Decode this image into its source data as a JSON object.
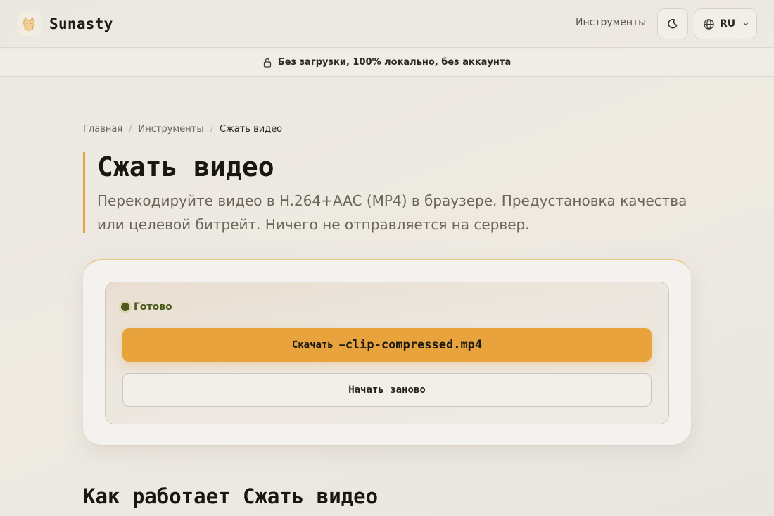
{
  "header": {
    "brand": "Sunasty",
    "nav_tools": "Инструменты",
    "lang": "RU",
    "icons": {
      "logo": "cat-logo-icon",
      "theme": "moon-icon",
      "lang": "globe-icon",
      "lang_chevron": "chevron-down-icon"
    }
  },
  "banner": {
    "text": "Без загрузки, 100% локально, без аккаунта",
    "icon": "lock-icon"
  },
  "breadcrumb": {
    "home": "Главная",
    "sep1": "/",
    "tools": "Инструменты",
    "sep2": "/",
    "current": "Сжать видео"
  },
  "hero": {
    "title": "Сжать видео",
    "description": "Перекодируйте видео в H.264+AAC (MP4) в браузере. Предустановка качества или целевой битрейт. Ничего не отправляется на сервер."
  },
  "result": {
    "status": "Готово",
    "download_prefix": "Скачать — ",
    "filename": "clip-compressed.mp4",
    "restart": "Начать заново"
  },
  "section": {
    "title": "Как работает Сжать видео"
  },
  "colors": {
    "accent": "#e8a33d",
    "status_green": "#4b5a1c"
  }
}
